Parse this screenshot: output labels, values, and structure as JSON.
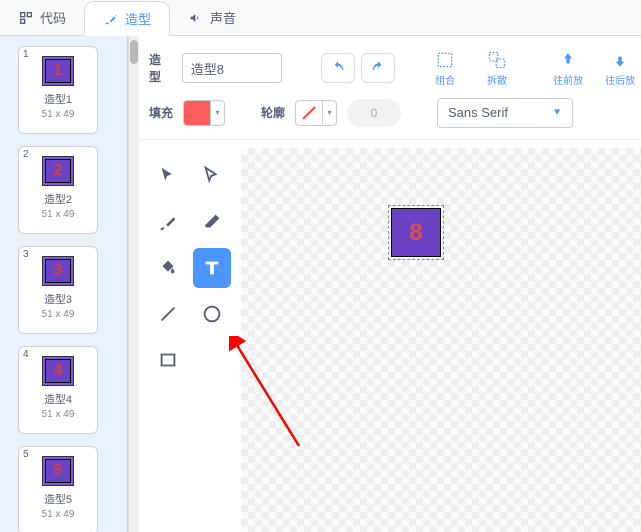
{
  "tabs": {
    "code": "代码",
    "costumes": "造型",
    "sounds": "声音"
  },
  "sidebar": {
    "items": [
      {
        "num": "1",
        "digit": "1",
        "name": "造型1",
        "size": "51 x 49"
      },
      {
        "num": "2",
        "digit": "2",
        "name": "造型2",
        "size": "51 x 49"
      },
      {
        "num": "3",
        "digit": "3",
        "name": "造型3",
        "size": "51 x 49"
      },
      {
        "num": "4",
        "digit": "4",
        "name": "造型4",
        "size": "51 x 49"
      },
      {
        "num": "5",
        "digit": "5",
        "name": "造型5",
        "size": "51 x 49"
      }
    ]
  },
  "editor": {
    "name_label": "造型",
    "name_value": "造型8",
    "group": "组合",
    "ungroup": "拆散",
    "forward": "往前放",
    "backward": "往后放",
    "fill_label": "填充",
    "stroke_label": "轮廓",
    "stroke_width": "0",
    "font": "Sans Serif",
    "colors": {
      "fill": "#ff5c5c"
    }
  },
  "canvas": {
    "sprite_text": "8"
  }
}
